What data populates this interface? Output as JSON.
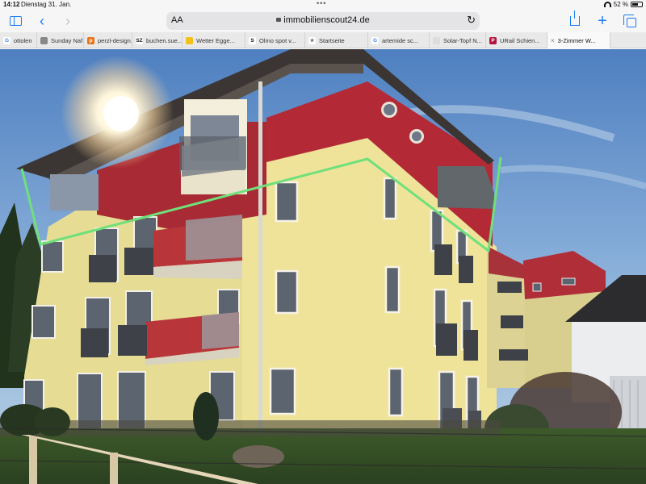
{
  "status": {
    "time": "14:12",
    "date": "Dienstag 31. Jan.",
    "battery": "52 %"
  },
  "toolbar": {
    "reader": "AA",
    "url": "immobilienscout24.de"
  },
  "tabs": [
    {
      "label": "ottolen",
      "favicon": "google-favicon",
      "color": "#ffffff",
      "glyph": "G",
      "glyph_color": "#4285f4"
    },
    {
      "label": "Sunday Naf",
      "favicon": "grey-circle-favicon",
      "color": "#888888",
      "glyph": "",
      "glyph_color": "#ffffff"
    },
    {
      "label": "perzl-design...",
      "favicon": "orange-favicon",
      "color": "#e8741c",
      "glyph": "p",
      "glyph_color": "#ffffff"
    },
    {
      "label": "buchen.sue...",
      "favicon": "sz-favicon",
      "color": "#ffffff",
      "glyph": "SZ",
      "glyph_color": "#111111"
    },
    {
      "label": "Wetter Egge...",
      "favicon": "weather-favicon",
      "color": "#f3c21a",
      "glyph": "",
      "glyph_color": "#ffffff"
    },
    {
      "label": "Olmo spot v...",
      "favicon": "s-favicon",
      "color": "#ffffff",
      "glyph": "S",
      "glyph_color": "#111111"
    },
    {
      "label": "Startseite",
      "favicon": "star-favicon",
      "color": "#ffffff",
      "glyph": "★",
      "glyph_color": "#777777"
    },
    {
      "label": "artemide sc...",
      "favicon": "google-favicon",
      "color": "#ffffff",
      "glyph": "G",
      "glyph_color": "#4285f4"
    },
    {
      "label": "Solar-Topf N...",
      "favicon": "blank-favicon",
      "color": "#dddddd",
      "glyph": "",
      "glyph_color": "#ffffff"
    },
    {
      "label": "URail Schien...",
      "favicon": "p-favicon",
      "color": "#b3123b",
      "glyph": "P",
      "glyph_color": "#ffffff"
    },
    {
      "label": "3-Zimmer W...",
      "favicon": "close-favicon",
      "color": "#ffffff",
      "glyph": "×",
      "glyph_color": "#666666",
      "active": true
    }
  ],
  "colors": {
    "accent": "#1a7cf5",
    "marking": "#6fe07a",
    "facade_yellow": "#efe39a",
    "facade_red": "#b32a36"
  }
}
